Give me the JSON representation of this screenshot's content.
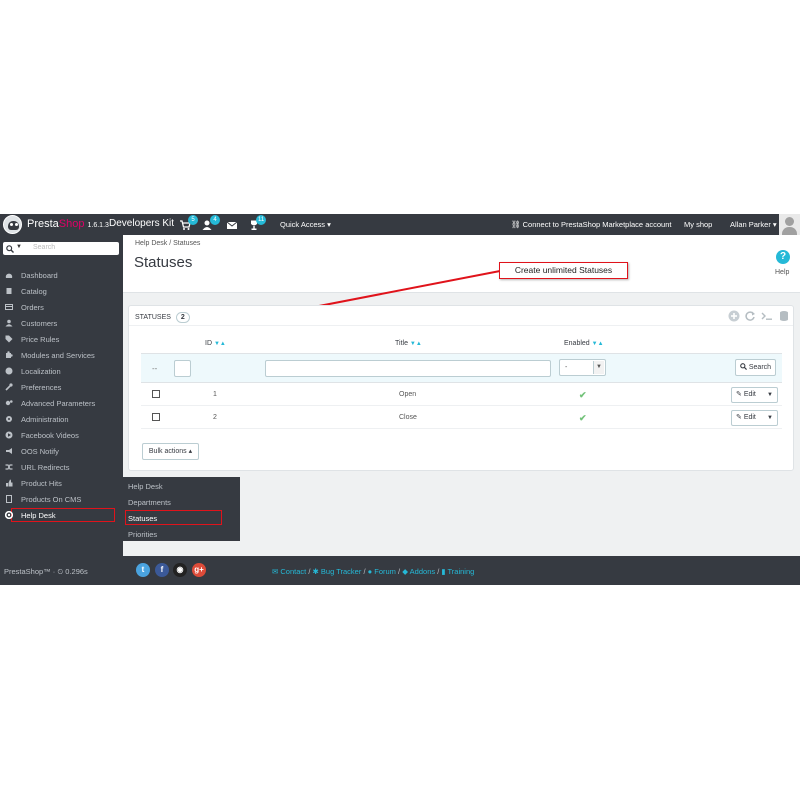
{
  "header": {
    "brand_presta": "Presta",
    "brand_shop": "Shop",
    "version": "1.6.1.3",
    "kit_label": "Developers Kit",
    "cart_badge": "5",
    "customers_badge": "4",
    "trophy_badge": "11",
    "quick_access": "Quick Access ▾",
    "connect": "Connect to PrestaShop Marketplace account",
    "my_shop": "My shop",
    "user": "Allan Parker ▾"
  },
  "sidebar": {
    "search_placeholder": "Search",
    "items": [
      {
        "label": "Dashboard",
        "icon": "dashboard-icon"
      },
      {
        "label": "Catalog",
        "icon": "catalog-icon"
      },
      {
        "label": "Orders",
        "icon": "orders-icon"
      },
      {
        "label": "Customers",
        "icon": "customers-icon"
      },
      {
        "label": "Price Rules",
        "icon": "price-tag-icon"
      },
      {
        "label": "Modules and Services",
        "icon": "puzzle-icon"
      },
      {
        "label": "Localization",
        "icon": "globe-icon"
      },
      {
        "label": "Preferences",
        "icon": "wrench-icon"
      },
      {
        "label": "Advanced Parameters",
        "icon": "cogs-icon"
      },
      {
        "label": "Administration",
        "icon": "gear-icon"
      },
      {
        "label": "Facebook Videos",
        "icon": "play-icon"
      },
      {
        "label": "OOS Notify",
        "icon": "megaphone-icon"
      },
      {
        "label": "URL Redirects",
        "icon": "shuffle-icon"
      },
      {
        "label": "Product Hits",
        "icon": "thumb-icon"
      },
      {
        "label": "Products On CMS",
        "icon": "file-icon"
      },
      {
        "label": "Help Desk",
        "icon": "lifebuoy-icon"
      }
    ]
  },
  "submenu": {
    "items": [
      "Help Desk",
      "Departments",
      "Statuses",
      "Priorities"
    ]
  },
  "page": {
    "breadcrumb": "Help Desk  /  Statuses",
    "title": "Statuses",
    "help_label": "Help",
    "callout": "Create unlimited Statuses"
  },
  "panel": {
    "title": "STATUSES",
    "count": "2",
    "columns": {
      "id": "ID",
      "title": "Title",
      "enabled": "Enabled"
    },
    "filter_dash": "--",
    "enabled_select": "-",
    "search_button": "Search",
    "rows": [
      {
        "id": "1",
        "title": "Open",
        "edit": "Edit"
      },
      {
        "id": "2",
        "title": "Close",
        "edit": "Edit"
      }
    ],
    "bulk_actions": "Bulk actions ▴"
  },
  "footer": {
    "text": "PrestaShop™ · ⏲ 0.296s",
    "links": [
      "Contact",
      "Bug Tracker",
      "Forum",
      "Addons",
      "Training"
    ]
  },
  "colors": {
    "dark": "#363a41",
    "accent": "#25b9d7",
    "highlight": "#e0131b",
    "check": "#72c279",
    "brand_pink": "#df0067"
  }
}
